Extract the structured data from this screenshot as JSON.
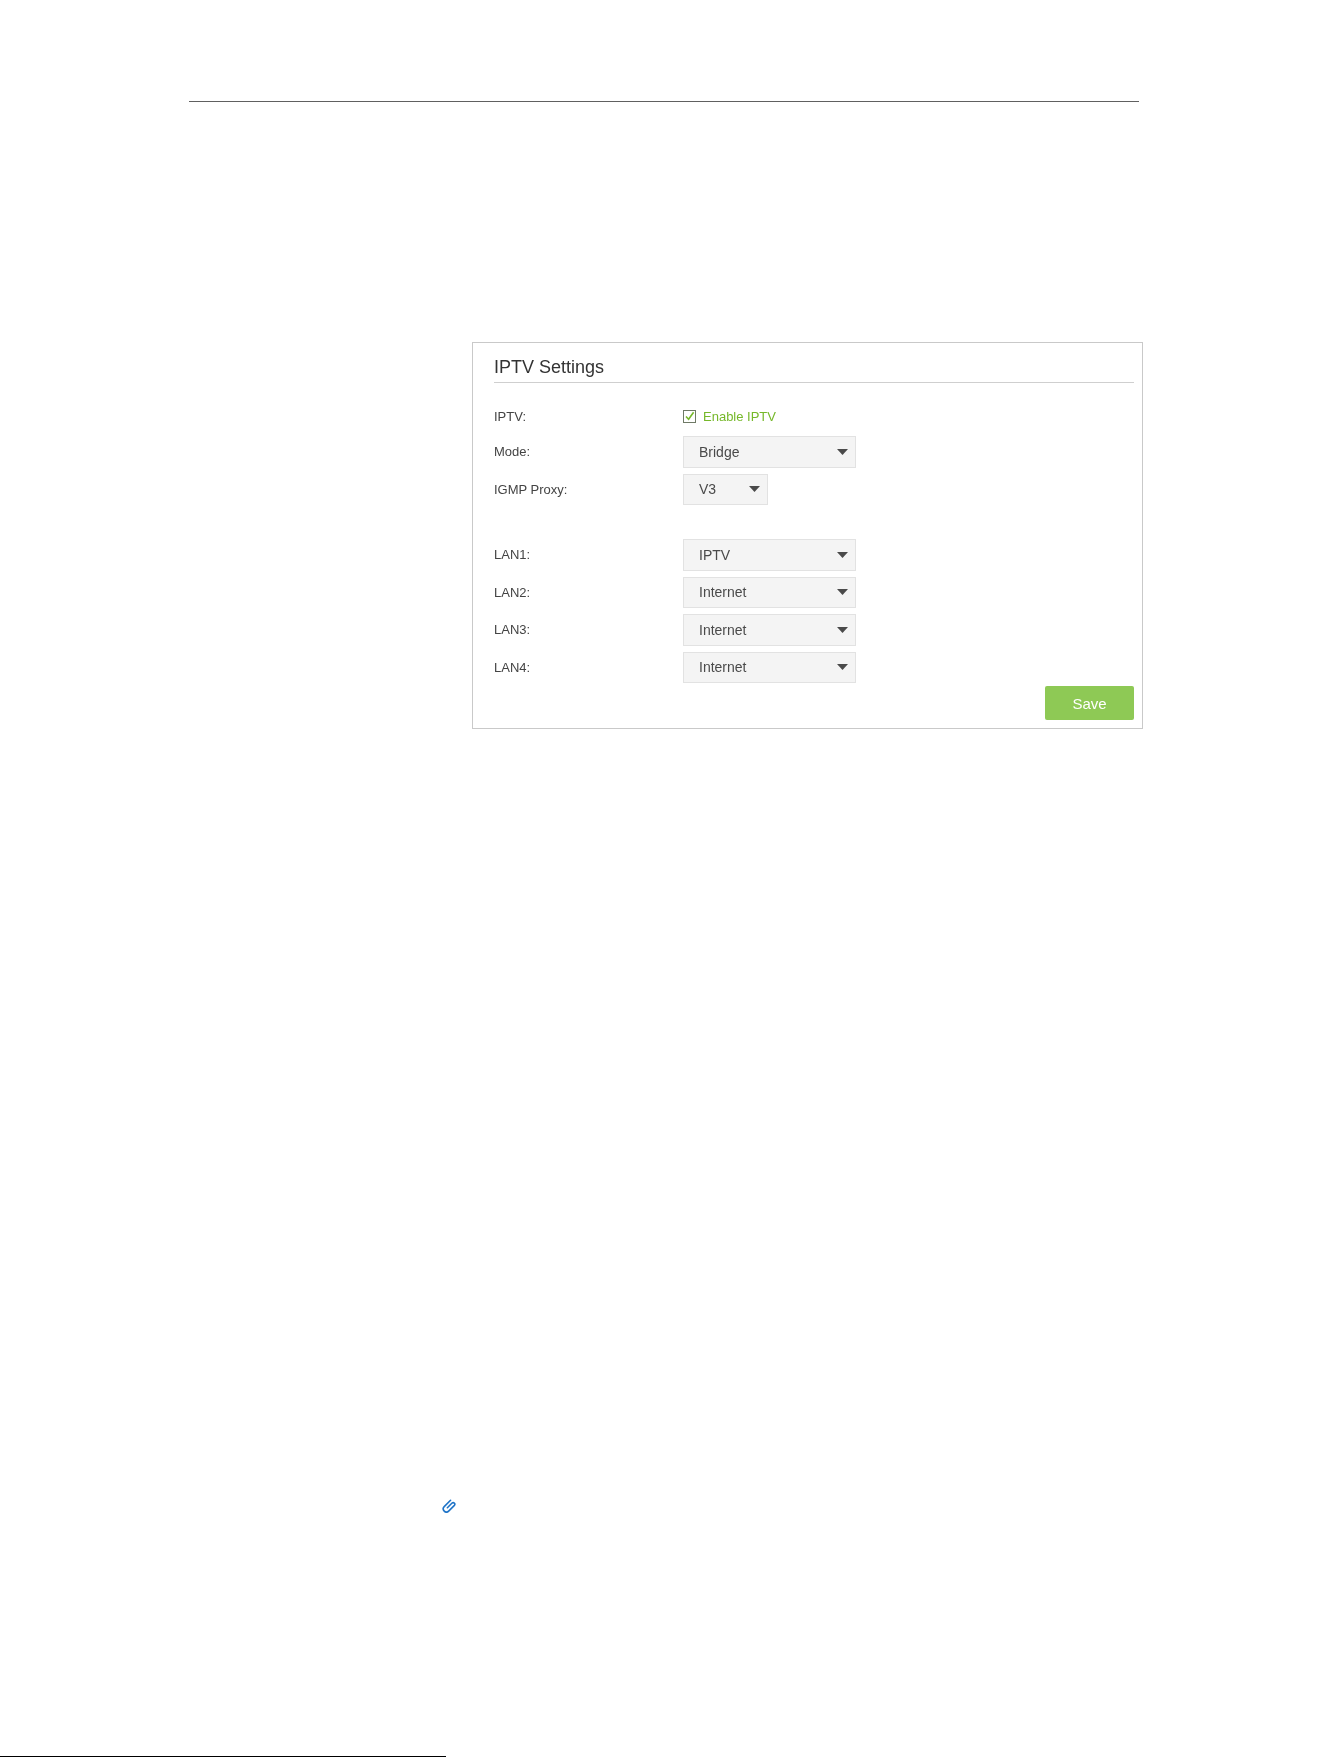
{
  "panel": {
    "title": "IPTV Settings",
    "sections": [
      {
        "fields": [
          {
            "kind": "checkbox",
            "label": "IPTV:",
            "option": "Enable IPTV",
            "checked": true
          },
          {
            "kind": "select",
            "label": "Mode:",
            "value": "Bridge"
          },
          {
            "kind": "short-select",
            "label": "IGMP Proxy:",
            "value": "V3"
          }
        ]
      },
      {
        "fields": [
          {
            "kind": "select",
            "label": "LAN1:",
            "value": "IPTV"
          },
          {
            "kind": "select",
            "label": "LAN2:",
            "value": "Internet"
          },
          {
            "kind": "select",
            "label": "LAN3:",
            "value": "Internet"
          },
          {
            "kind": "select",
            "label": "LAN4:",
            "value": "Internet"
          }
        ]
      }
    ],
    "save_button": "Save"
  }
}
